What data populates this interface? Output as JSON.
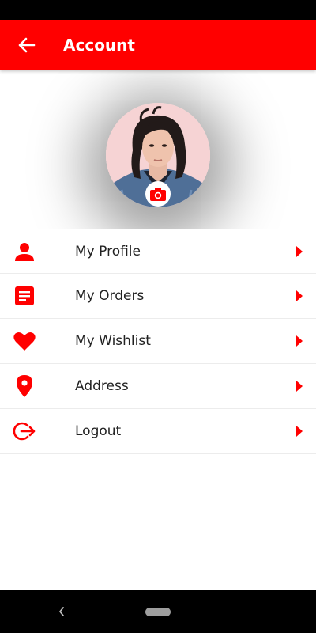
{
  "app_bar": {
    "title": "Account",
    "back_icon": "arrow-left-icon",
    "background": "#ff0000"
  },
  "profile": {
    "avatar": "profile-photo",
    "camera_icon": "camera-icon"
  },
  "menu": {
    "items": [
      {
        "label": "My Profile",
        "icon": "person-icon"
      },
      {
        "label": "My Orders",
        "icon": "orders-icon"
      },
      {
        "label": "My Wishlist",
        "icon": "heart-icon"
      },
      {
        "label": "Address",
        "icon": "location-pin-icon"
      },
      {
        "label": "Logout",
        "icon": "logout-icon"
      }
    ]
  },
  "colors": {
    "accent": "#ff0000",
    "text": "#222222"
  }
}
